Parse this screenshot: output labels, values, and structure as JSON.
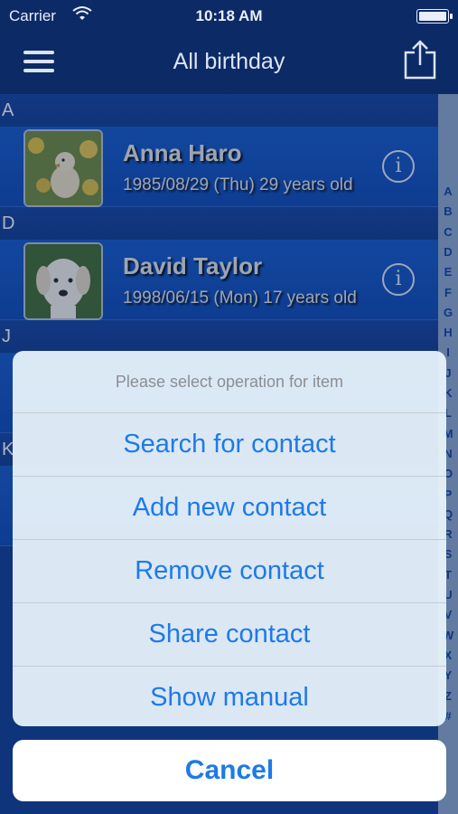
{
  "status_bar": {
    "carrier": "Carrier",
    "time": "10:18 AM"
  },
  "navbar": {
    "title": "All birthday"
  },
  "sections": [
    {
      "letter": "A",
      "contact": {
        "name": "Anna Haro",
        "detail": "1985/08/29 (Thu) 29 years old",
        "avatar": "duckling-photo"
      }
    },
    {
      "letter": "D",
      "contact": {
        "name": "David Taylor",
        "detail": "1998/06/15 (Mon) 17 years old",
        "avatar": "puppy-photo"
      }
    },
    {
      "letter": "J"
    },
    {
      "letter": "K"
    }
  ],
  "index_letters": [
    "A",
    "B",
    "C",
    "D",
    "E",
    "F",
    "G",
    "H",
    "I",
    "J",
    "K",
    "L",
    "M",
    "N",
    "O",
    "P",
    "Q",
    "R",
    "S",
    "T",
    "U",
    "V",
    "W",
    "X",
    "Y",
    "Z",
    "#"
  ],
  "action_sheet": {
    "prompt": "Please select operation for item",
    "options": [
      "Search for contact",
      "Add new contact",
      "Remove contact",
      "Share contact",
      "Show manual"
    ],
    "cancel": "Cancel"
  },
  "colors": {
    "accent": "#1d7ae8",
    "navbar": "#0c2a66",
    "row": "#0b48b4"
  }
}
